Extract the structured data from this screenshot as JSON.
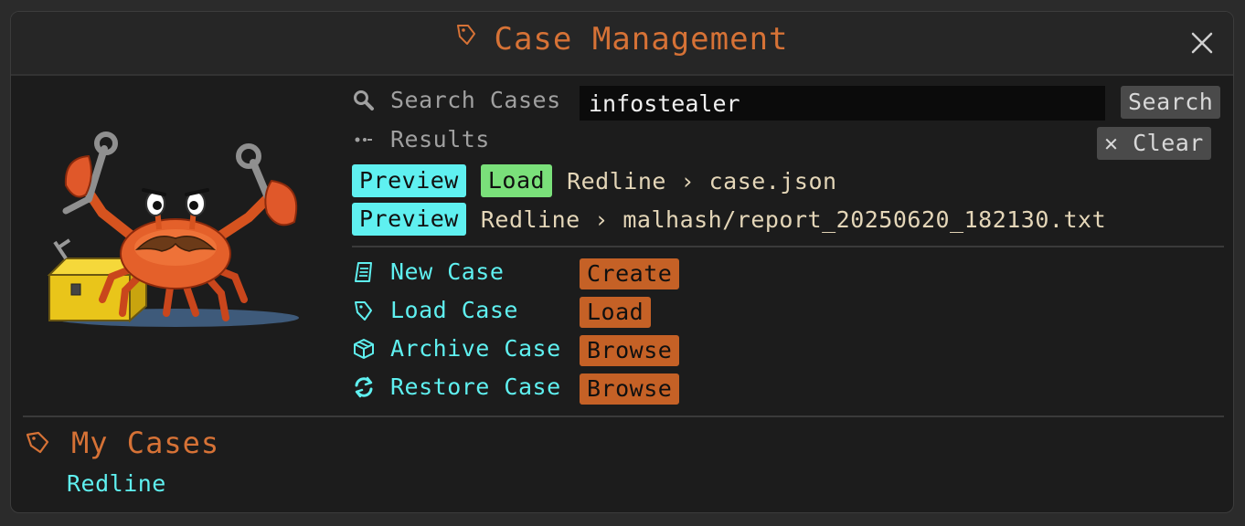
{
  "window": {
    "title": "Case Management",
    "title_icon": "tag-icon",
    "close_icon": "close-icon"
  },
  "search": {
    "label": "Search Cases",
    "value": "infostealer",
    "button_label": "Search",
    "icon": "search-icon"
  },
  "results": {
    "label": "Results",
    "icon": "dots-icon",
    "clear_label": "✕ Clear",
    "items": [
      {
        "preview_label": "Preview",
        "load_label": "Load",
        "path": "Redline › case.json"
      },
      {
        "preview_label": "Preview",
        "path": "Redline › malhash/report_20250620_182130.txt"
      }
    ]
  },
  "actions": [
    {
      "label": "New Case",
      "button": "Create",
      "icon": "document-icon"
    },
    {
      "label": "Load Case",
      "button": "Load",
      "icon": "tag-icon"
    },
    {
      "label": "Archive Case",
      "button": "Browse",
      "icon": "box-icon"
    },
    {
      "label": "Restore Case",
      "button": "Browse",
      "icon": "refresh-icon"
    }
  ],
  "my_cases": {
    "title": "My Cases",
    "icon": "tag-icon",
    "items": [
      "Redline"
    ]
  },
  "colors": {
    "accent_orange": "#d67236",
    "cyan": "#5ff0f0",
    "green": "#7ae07a",
    "button_orange": "#c56126",
    "background": "#1c1c1c"
  }
}
